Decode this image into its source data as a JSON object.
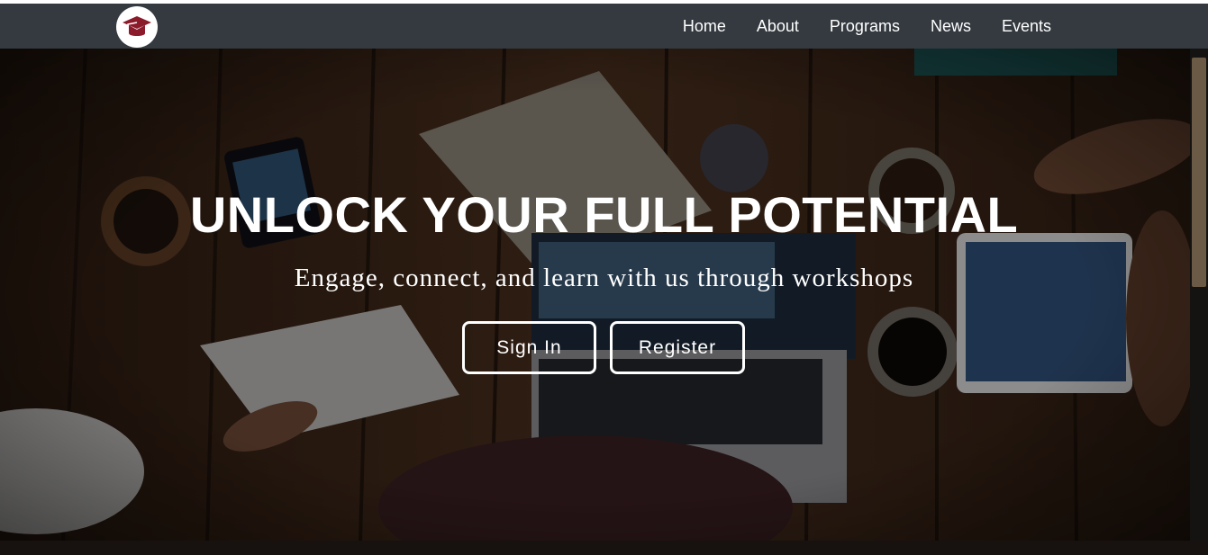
{
  "brand": {
    "logo_icon": "graduation-cap-icon",
    "logo_color": "#8b1a2b"
  },
  "nav": {
    "items": [
      {
        "label": "Home"
      },
      {
        "label": "About"
      },
      {
        "label": "Programs"
      },
      {
        "label": "News"
      },
      {
        "label": "Events"
      }
    ]
  },
  "hero": {
    "headline": "UNLOCK YOUR FULL POTENTIAL",
    "subheadline": "Engage, connect, and learn with us through workshops",
    "buttons": {
      "sign_in": "Sign In",
      "register": "Register"
    }
  },
  "colors": {
    "navbar_bg": "#343a40",
    "nav_text": "#ffffff",
    "button_border": "#ffffff"
  }
}
